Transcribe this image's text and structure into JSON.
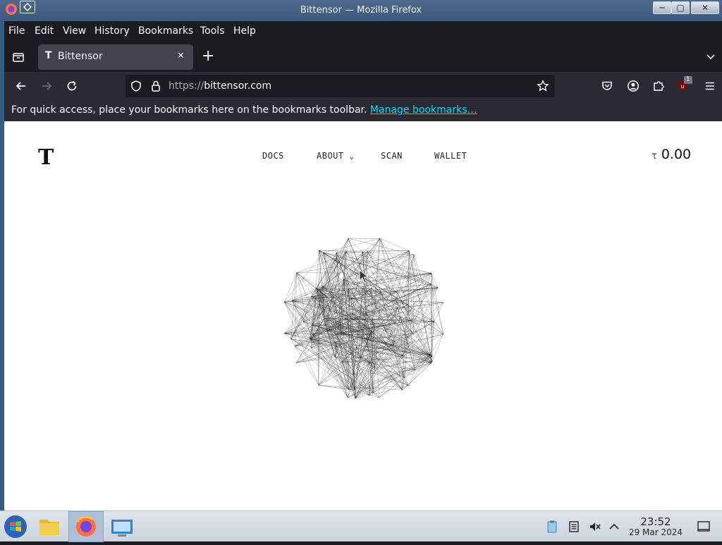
{
  "window": {
    "title": "Bittensor — Mozilla Firefox",
    "controls": {
      "minimize": "─",
      "maximize": "▢",
      "close": "✕"
    }
  },
  "menubar": {
    "items": [
      "File",
      "Edit",
      "View",
      "History",
      "Bookmarks",
      "Tools",
      "Help"
    ]
  },
  "tabs": {
    "active_tab": {
      "favicon": "T",
      "label": "Bittensor",
      "close": "✕"
    },
    "new_tab": "+"
  },
  "navbar": {
    "url_protocol": "https://",
    "url_host": "bittensor.com",
    "extension_badge": "1"
  },
  "bookmarks_bar": {
    "message": "For quick access, place your bookmarks here on the bookmarks toolbar.",
    "link": "Manage bookmarks…"
  },
  "site": {
    "logo": "T",
    "nav": [
      "DOCS",
      "ABOUT",
      "SCAN",
      "WALLET"
    ],
    "about_chevron": "⌄",
    "balance_symbol": "τ",
    "balance_value": "0.00"
  },
  "taskbar": {
    "time": "23:52",
    "date": "29 Mar 2024",
    "apps": [
      "start-menu-icon",
      "file-manager-icon",
      "firefox-icon",
      "system-settings-icon"
    ]
  },
  "colors": {
    "browser_bg": "#1c1b22",
    "toolbar_bg": "#2b2a33",
    "link": "#00ddff",
    "page_bg": "#ffffff"
  }
}
